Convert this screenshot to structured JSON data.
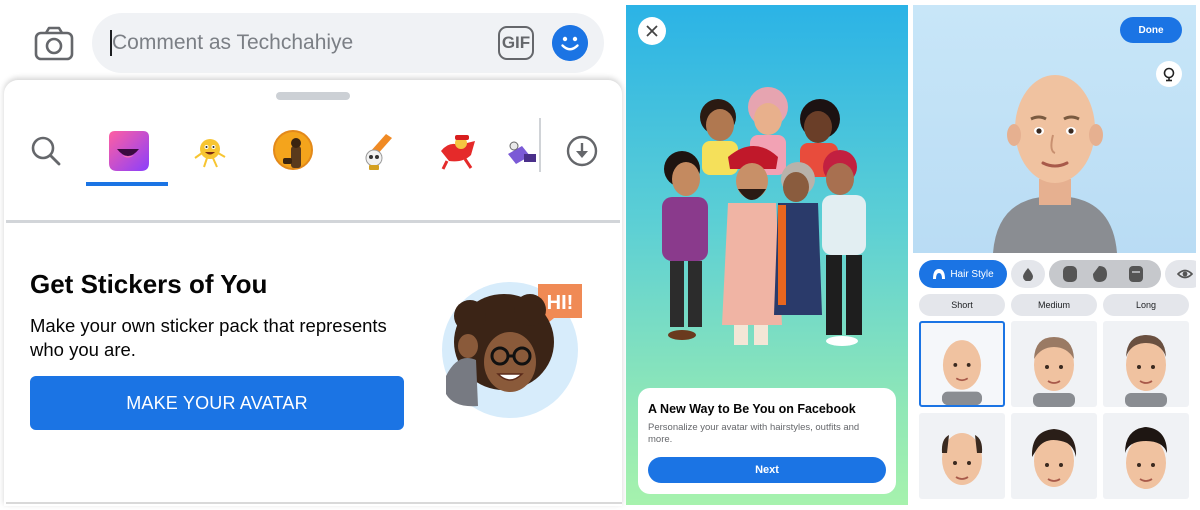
{
  "panel1": {
    "comment": {
      "placeholder": "Comment as Techchahiye"
    },
    "gif_label": "GIF",
    "promo": {
      "title": "Get Stickers of You",
      "description": "Make your own sticker pack that represents who you are.",
      "button": "MAKE YOUR AVATAR",
      "bubble_text": "HI!"
    },
    "icons": [
      "camera-icon",
      "gif-icon",
      "emoji-icon",
      "search-icon",
      "download-icon"
    ],
    "colors": {
      "accent": "#1b74e4",
      "field_bg": "#f0f2f5"
    }
  },
  "panel2": {
    "card": {
      "title": "A New Way to Be You on Facebook",
      "description": "Personalize your avatar with hairstyles, outfits and more.",
      "button": "Next"
    }
  },
  "panel3": {
    "done": "Done",
    "category": "Hair Style",
    "lengths": [
      "Short",
      "Medium",
      "Long"
    ]
  }
}
